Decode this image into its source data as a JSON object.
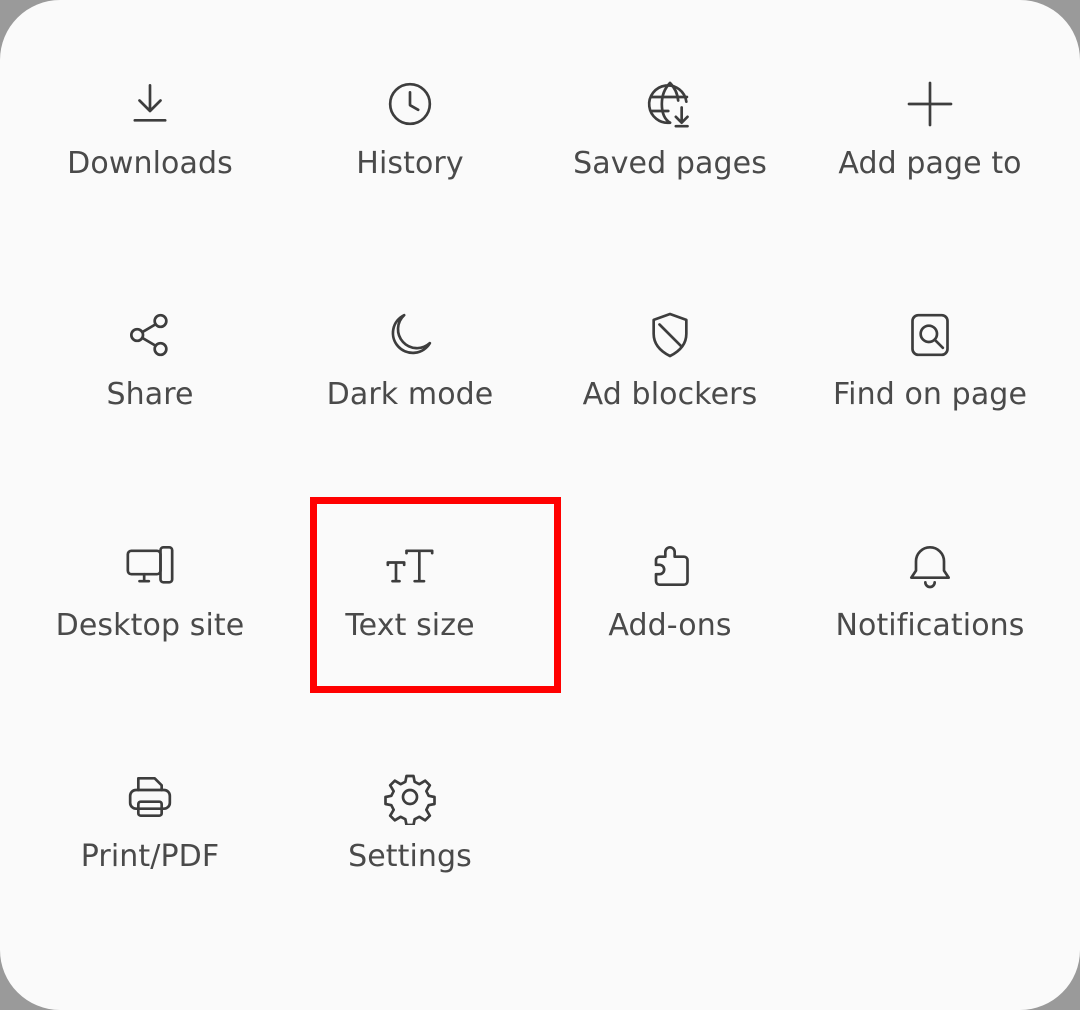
{
  "menu": {
    "items": [
      {
        "label": "Downloads",
        "icon": "download-icon"
      },
      {
        "label": "History",
        "icon": "clock-icon"
      },
      {
        "label": "Saved pages",
        "icon": "saved-pages-globe-icon"
      },
      {
        "label": "Add page to",
        "icon": "plus-icon"
      },
      {
        "label": "Share",
        "icon": "share-icon"
      },
      {
        "label": "Dark mode",
        "icon": "moon-icon"
      },
      {
        "label": "Ad blockers",
        "icon": "shield-icon"
      },
      {
        "label": "Find on page",
        "icon": "find-on-page-icon"
      },
      {
        "label": "Desktop site",
        "icon": "desktop-icon"
      },
      {
        "label": "Text size",
        "icon": "text-size-icon"
      },
      {
        "label": "Add-ons",
        "icon": "puzzle-icon"
      },
      {
        "label": "Notifications",
        "icon": "bell-icon"
      },
      {
        "label": "Print/PDF",
        "icon": "printer-icon"
      },
      {
        "label": "Settings",
        "icon": "gear-icon"
      }
    ]
  },
  "colors": {
    "panel_background": "#fafafa",
    "icon_color": "#3d3d3d",
    "label_color": "#4a4a4a",
    "highlight_border": "#ff0000"
  },
  "highlighted_item": "Text size"
}
